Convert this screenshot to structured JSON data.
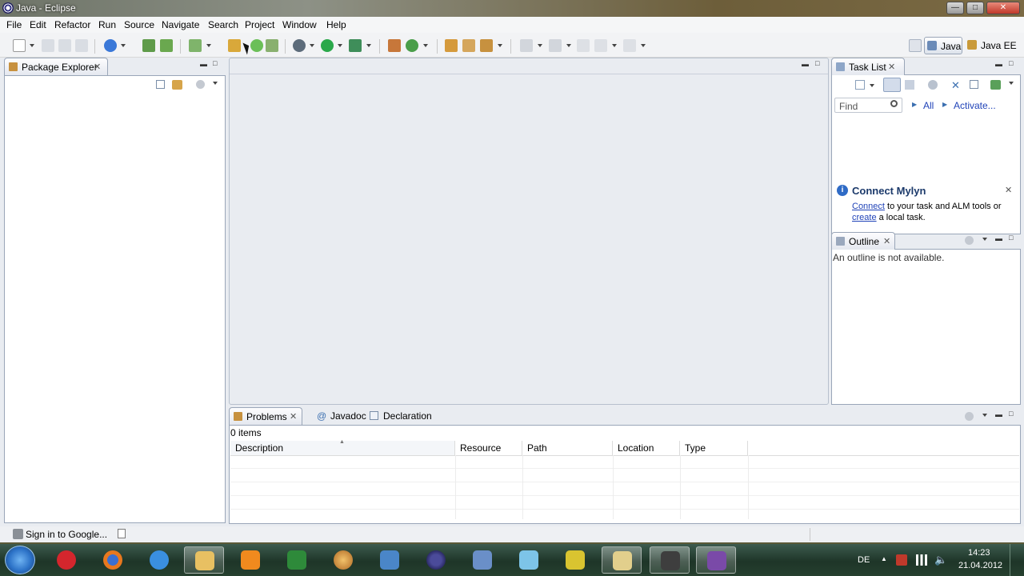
{
  "window": {
    "title": "Java - Eclipse"
  },
  "menu": [
    "File",
    "Edit",
    "Refactor",
    "Run",
    "Source",
    "Navigate",
    "Search",
    "Project",
    "Window",
    "Help"
  ],
  "perspectives": {
    "java": "Java",
    "java_ee": "Java EE"
  },
  "package_explorer": {
    "title": "Package Explorer"
  },
  "task_list": {
    "title": "Task List",
    "find_placeholder": "Find",
    "all": "All",
    "activate": "Activate..."
  },
  "mylyn": {
    "title": "Connect Mylyn",
    "connect": "Connect",
    "text1": " to your task and ALM tools or",
    "create": "create",
    "text2": " a local task."
  },
  "outline": {
    "title": "Outline",
    "message": "An outline is not available."
  },
  "bottom_panel": {
    "tabs": [
      "Problems",
      "Javadoc",
      "Declaration"
    ],
    "count": "0 items",
    "columns": [
      "Description",
      "Resource",
      "Path",
      "Location",
      "Type"
    ]
  },
  "status": {
    "sign_in": "Sign in to Google..."
  },
  "tray": {
    "lang": "DE",
    "time": "14:23",
    "date": "21.04.2012"
  },
  "colors": {
    "link": "#2043b8",
    "view_border": "#9aa6b8",
    "highlight": "#f5e500"
  }
}
